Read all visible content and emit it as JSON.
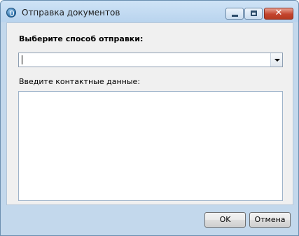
{
  "window": {
    "title": "Отправка документов",
    "icon": "app-icon",
    "controls": {
      "minimize": "minimize-icon",
      "maximize": "maximize-icon",
      "close": "close-icon"
    }
  },
  "form": {
    "method_label": "Выберите способ отправки:",
    "method_value": "",
    "contact_label": "Введите контактные данные:",
    "contact_value": ""
  },
  "buttons": {
    "ok": "OK",
    "cancel": "Отмена"
  }
}
